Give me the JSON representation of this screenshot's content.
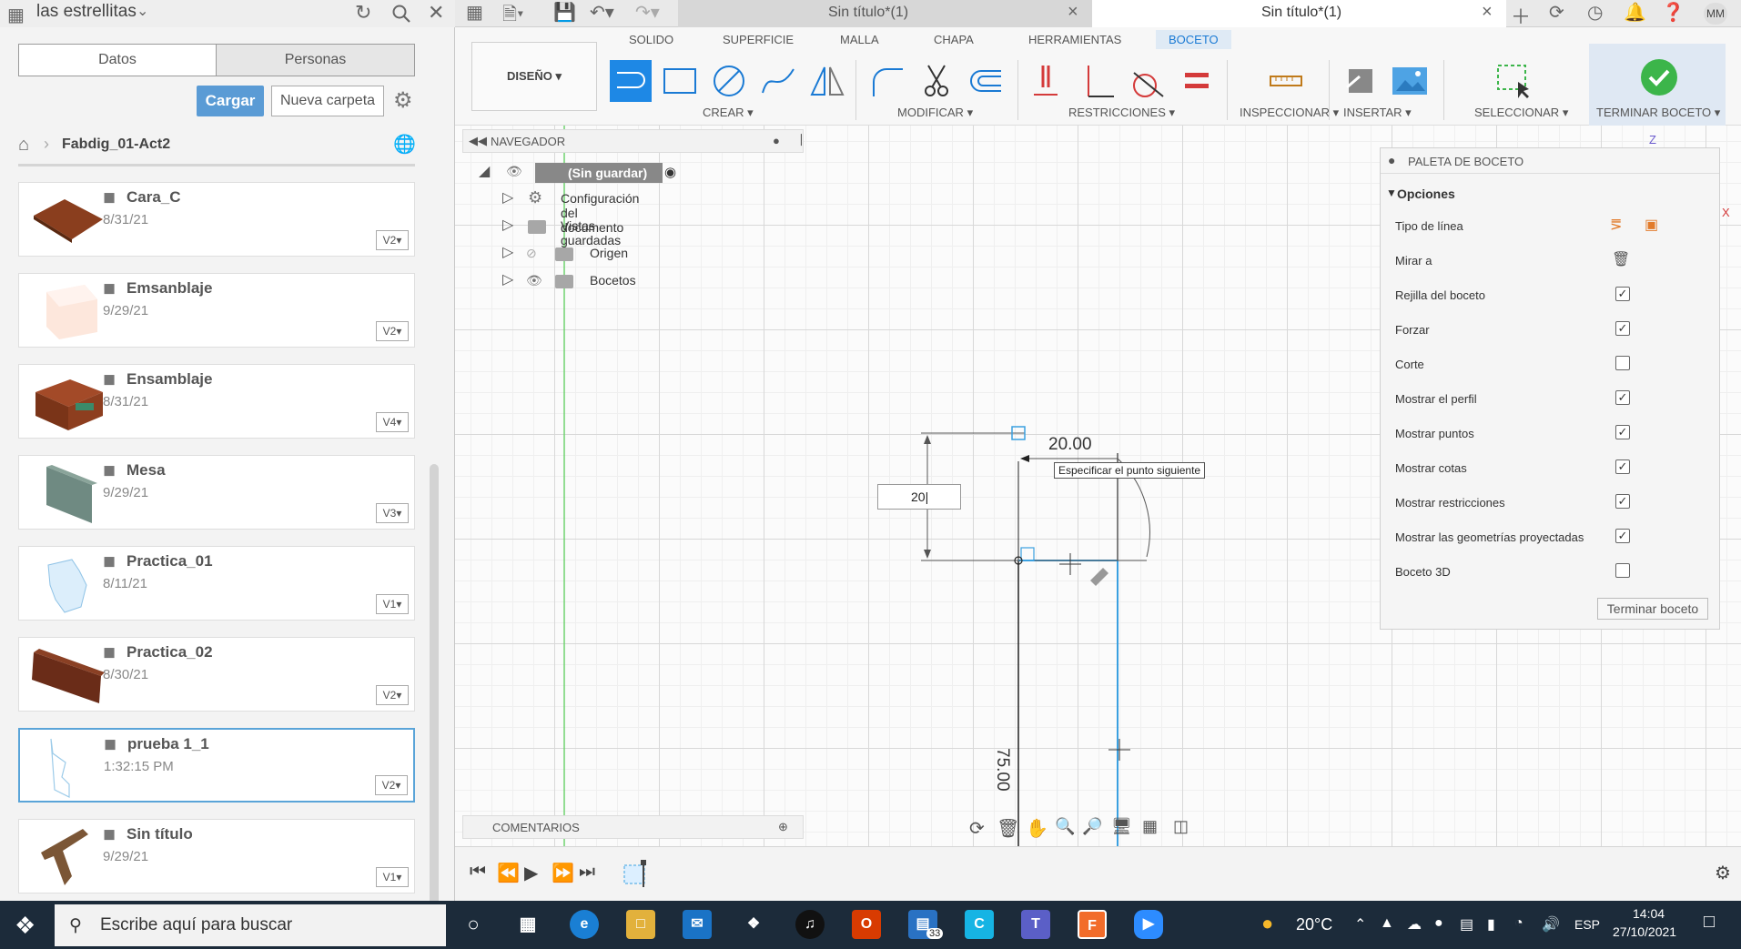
{
  "top": {
    "team_name": "las estrellitas",
    "tab_inactive": "Sin título*(1)",
    "tab_active": "Sin título*(1)",
    "avatar": "MM"
  },
  "data_panel": {
    "tab_datos": "Datos",
    "tab_personas": "Personas",
    "btn_cargar": "Cargar",
    "btn_nueva_carpeta": "Nueva carpeta",
    "breadcrumb": "Fabdig_01-Act2",
    "files": [
      {
        "name": "Cara_C",
        "date": "8/31/21",
        "version": "V2"
      },
      {
        "name": "Emsanblaje",
        "date": "9/29/21",
        "version": "V2"
      },
      {
        "name": "Ensamblaje",
        "date": "8/31/21",
        "version": "V4"
      },
      {
        "name": "Mesa",
        "date": "9/29/21",
        "version": "V3"
      },
      {
        "name": "Practica_01",
        "date": "8/11/21",
        "version": "V1"
      },
      {
        "name": "Practica_02",
        "date": "8/30/21",
        "version": "V2"
      },
      {
        "name": "prueba 1_1",
        "date": "1:32:15 PM",
        "version": "V2"
      },
      {
        "name": "Sin título",
        "date": "9/29/21",
        "version": "V1"
      }
    ]
  },
  "toolbar": {
    "workspace": "DISEÑO",
    "tabs": [
      "SOLIDO",
      "SUPERFICIE",
      "MALLA",
      "CHAPA",
      "HERRAMIENTAS",
      "BOCETO"
    ],
    "groups": {
      "crear": "CREAR",
      "modificar": "MODIFICAR",
      "restricciones": "RESTRICCIONES",
      "inspeccionar": "INSPECCIONAR",
      "insertar": "INSERTAR",
      "seleccionar": "SELECCIONAR",
      "terminar": "TERMINAR BOCETO"
    }
  },
  "navigator": {
    "title": "NAVEGADOR",
    "root": "(Sin guardar)",
    "items": [
      "Configuración del documento",
      "Vistas guardadas",
      "Origen",
      "Bocetos"
    ]
  },
  "comments": {
    "title": "COMENTARIOS"
  },
  "palette": {
    "title": "PALETA DE BOCETO",
    "section": "Opciones",
    "rows": [
      {
        "label": "Tipo de línea",
        "checked": null
      },
      {
        "label": "Mirar a",
        "checked": null
      },
      {
        "label": "Rejilla del boceto",
        "checked": true
      },
      {
        "label": "Forzar",
        "checked": true
      },
      {
        "label": "Corte",
        "checked": false
      },
      {
        "label": "Mostrar el perfil",
        "checked": true
      },
      {
        "label": "Mostrar puntos",
        "checked": true
      },
      {
        "label": "Mostrar cotas",
        "checked": true
      },
      {
        "label": "Mostrar restricciones",
        "checked": true
      },
      {
        "label": "Mostrar las geometrías proyectadas",
        "checked": true
      },
      {
        "label": "Boceto 3D",
        "checked": false
      }
    ],
    "finish_button": "Terminar boceto"
  },
  "sketch": {
    "dim_horizontal": "20.00",
    "dim_vertical": "75.00",
    "input_value": "20",
    "tooltip": "Especificar el punto siguiente",
    "axis_z": "Z",
    "axis_x": "X"
  },
  "taskbar": {
    "search_placeholder": "Escribe aquí para buscar",
    "badge": "33",
    "temperature": "20°C",
    "lang": "ESP",
    "time": "14:04",
    "date": "27/10/2021"
  },
  "colors": {
    "accent": "#1a7ad4",
    "sketch_blue": "#3aa0e0",
    "finish_green": "#3cb54a"
  }
}
